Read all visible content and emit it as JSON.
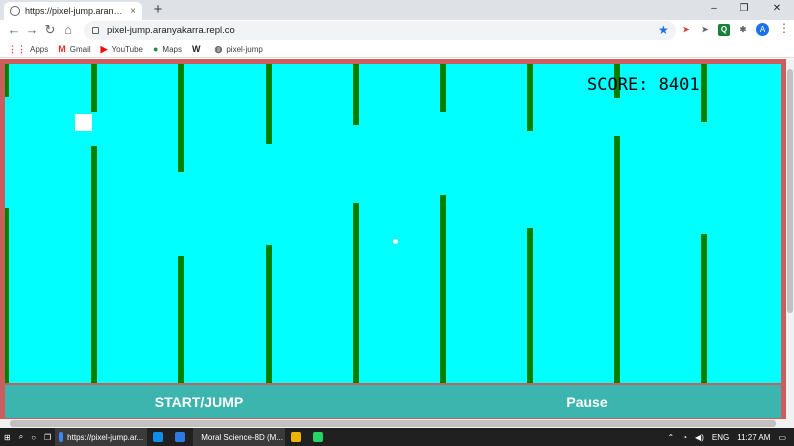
{
  "browser": {
    "tab_title": "https://pixel-jump.aranyakarra.repl",
    "tab_close": "×",
    "new_tab": "+",
    "url": "pixel-jump.aranyakarra.repl.co",
    "window_controls": [
      "–",
      "❐",
      "✕"
    ],
    "nav_icons": [
      "back-icon",
      "forward-icon",
      "reload-icon",
      "home-icon"
    ],
    "extensions": [
      {
        "name": "cursor-extension-icon",
        "label": "➤",
        "color": "#e53935"
      },
      {
        "name": "pointer-extension-icon",
        "label": "➤",
        "color": "#5f6368"
      },
      {
        "name": "q-extension-icon",
        "label": "Q",
        "color": "#188038"
      },
      {
        "name": "puzzle-extension-icon",
        "label": "✱",
        "color": "#5f6368"
      }
    ],
    "avatar": "A"
  },
  "bookmarks": [
    {
      "label": "Apps",
      "icon": "⋮⋮",
      "color": "#e8453c"
    },
    {
      "label": "Gmail",
      "icon": "M",
      "color": "#d93025"
    },
    {
      "label": "YouTube",
      "icon": "▶",
      "color": "#ff0000"
    },
    {
      "label": "Maps",
      "icon": "●",
      "color": "#1e8e3e"
    },
    {
      "label": "",
      "icon": "W",
      "color": "#202124"
    },
    {
      "label": "pixel-jump",
      "icon": "◍",
      "color": "#5f6368"
    }
  ],
  "game": {
    "score_label": "SCORE: 8401",
    "start_label": "START/JUMP",
    "pause_label": "Pause",
    "colors": {
      "border": "#cd5c5c",
      "sky": "#00ffff",
      "pipe": "#008000",
      "controls": "#3bb5ad"
    }
  },
  "taskbar": {
    "apps": [
      {
        "label": "https://pixel-jump.ar...",
        "color": "#4285f4"
      },
      {
        "label": "",
        "color": "#0f8fe8"
      },
      {
        "label": "",
        "color": "#2d7be3"
      },
      {
        "label": "Moral Science-8D (M...",
        "color": "#6264a7"
      },
      {
        "label": "",
        "color": "#f0b400"
      },
      {
        "label": "",
        "color": "#25d366"
      }
    ],
    "language": "ENG",
    "time": "11:27 AM"
  }
}
